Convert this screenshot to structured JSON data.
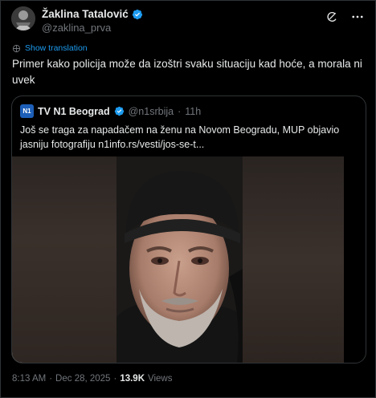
{
  "author": {
    "display_name": "Žaklina Tatalović",
    "handle": "@zaklina_prva"
  },
  "actions": {
    "grok_icon": "grok-icon",
    "more_icon": "more-icon"
  },
  "show_translation_label": "Show translation",
  "tweet_text": "Primer kako policija može da izoštri svaku situaciju kad hoće, a morala ni uvek",
  "quote": {
    "logo_text": "N1",
    "name": "TV N1 Beograd",
    "handle": "@n1srbija",
    "separator": "·",
    "time": "11h",
    "text": "Još se traga za napadačem na ženu na Novom Beogradu, MUP objavio jasniju fotografiju n1info.rs/vesti/jos-se-t..."
  },
  "footer": {
    "time": "8:13 AM",
    "dot": "·",
    "date": "Dec 28, 2025",
    "dot2": "·",
    "views_count": "13.9K",
    "views_label": "Views"
  },
  "colors": {
    "background": "#000000",
    "link": "#1d9bf0",
    "verified": "#1d9bf0",
    "muted": "#71767b"
  }
}
